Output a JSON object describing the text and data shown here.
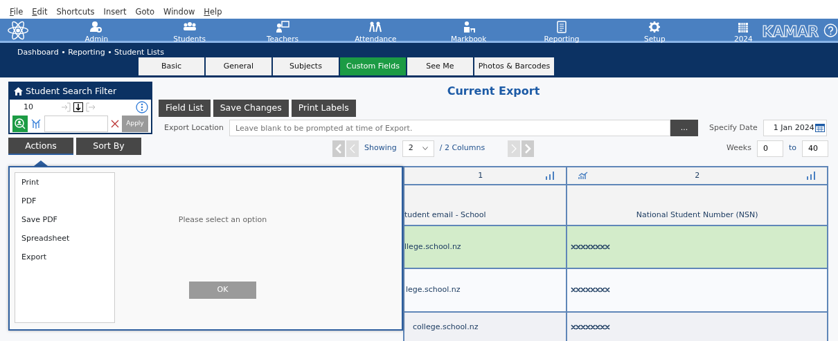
{
  "menu": [
    {
      "label": "File",
      "mnemonic": true
    },
    {
      "label": "Edit",
      "mnemonic": true
    },
    {
      "label": "Shortcuts",
      "mnemonic": false
    },
    {
      "label": "Insert",
      "mnemonic": false
    },
    {
      "label": "Goto",
      "mnemonic": false
    },
    {
      "label": "Window",
      "mnemonic": false
    },
    {
      "label": "Help",
      "mnemonic": true
    }
  ],
  "nav": [
    {
      "label": "Admin",
      "kind": "admin"
    },
    {
      "label": "Students",
      "kind": "students"
    },
    {
      "label": "Teachers",
      "kind": "teachers"
    },
    {
      "label": "Attendance",
      "kind": "attendance"
    },
    {
      "label": "Markbook",
      "kind": "markbook"
    },
    {
      "label": "Reporting",
      "kind": "reporting"
    },
    {
      "label": "Setup",
      "kind": "setup"
    }
  ],
  "year": "2024",
  "brand": "KAMAR",
  "breadcrumb": "Dashboard • Reporting • Student Lists",
  "tabs": [
    {
      "label": "Basic",
      "selected": false
    },
    {
      "label": "General",
      "selected": false
    },
    {
      "label": "Subjects",
      "selected": false
    },
    {
      "label": "Custom Fields",
      "selected": true
    },
    {
      "label": "See Me",
      "selected": false
    },
    {
      "label": "Photos & Barcodes",
      "selected": false
    }
  ],
  "filter": {
    "title": "Student Search Filter",
    "count": "10",
    "apply": "Apply"
  },
  "side_buttons": [
    {
      "label": "Actions",
      "selected": true
    },
    {
      "label": "Sort By",
      "selected": false
    }
  ],
  "title": "Current Export",
  "toolbar": [
    "Field List",
    "Save Changes",
    "Print Labels"
  ],
  "export_location": {
    "label": "Export Location",
    "placeholder": "Leave blank to be prompted at time of Export.",
    "browse": "..."
  },
  "specify_date": {
    "label": "Specify Date",
    "value": "1 Jan 2024"
  },
  "showing": {
    "label": "Showing",
    "value": "2",
    "total": "/ 2 Columns"
  },
  "weeks": {
    "label": "Weeks",
    "from": "0",
    "to_label": "to",
    "to": "40"
  },
  "table": {
    "numbers": [
      "1",
      "2"
    ],
    "columns": [
      "tudent email - School",
      "National Student Number (NSN)"
    ],
    "rows": [
      {
        "email": "llege.school.nz",
        "selected": true
      },
      {
        "email": "lege.school.nz",
        "selected": false
      },
      {
        "email": "college.school.nz",
        "selected": false
      }
    ]
  },
  "modal": {
    "options": [
      "Print",
      "PDF",
      "Save PDF",
      "Spreadsheet",
      "Export"
    ],
    "message": "Please select an option",
    "ok": "OK",
    "ok_disabled": true
  }
}
